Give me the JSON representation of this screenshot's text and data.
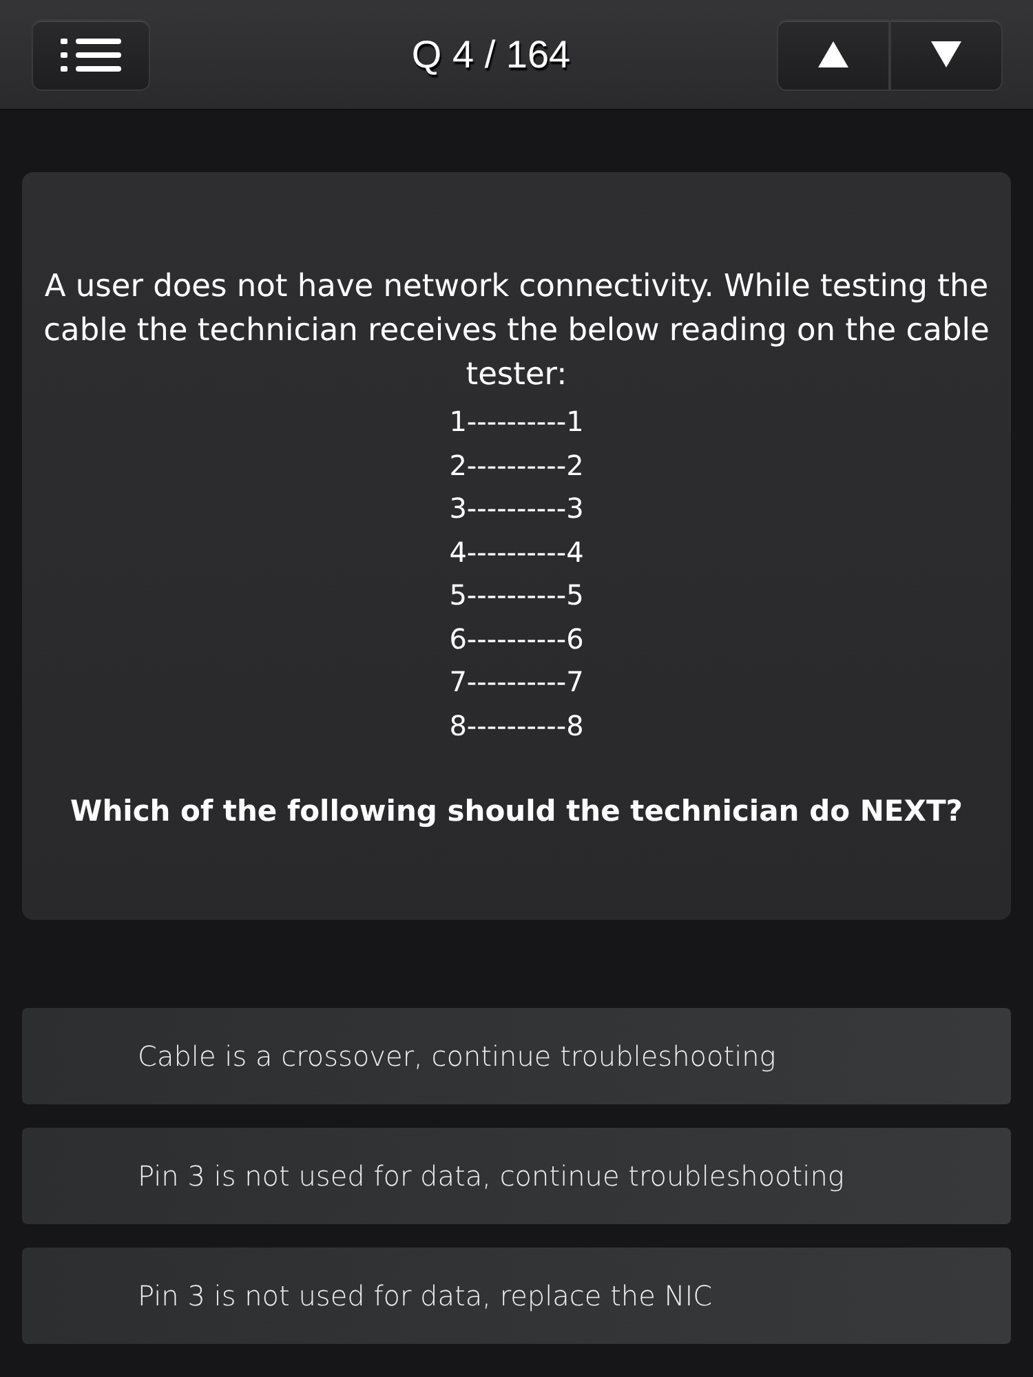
{
  "header": {
    "title": "Q 4 / 164"
  },
  "question": {
    "text": "A user does not have network connectivity. While testing the cable the technician receives the below reading on the cable tester:",
    "tester_lines": [
      "1----------1",
      "2----------2",
      "3----------3",
      "4----------4",
      "5----------5",
      "6----------6",
      "7----------7",
      "8----------8"
    ],
    "prompt": "Which of the following should the technician do NEXT?"
  },
  "answers": [
    {
      "text": "Cable is a crossover, continue troubleshooting"
    },
    {
      "text": "Pin 3 is not used for data, continue troubleshooting"
    },
    {
      "text": "Pin 3 is not used for data, replace the NIC"
    }
  ]
}
